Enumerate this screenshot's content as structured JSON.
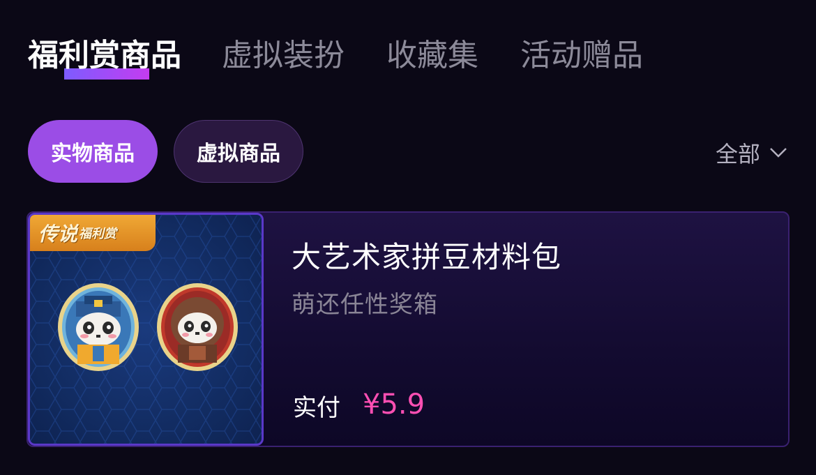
{
  "tabs": [
    {
      "label": "福利赏商品",
      "active": true
    },
    {
      "label": "虚拟装扮",
      "active": false
    },
    {
      "label": "收藏集",
      "active": false
    },
    {
      "label": "活动赠品",
      "active": false
    }
  ],
  "chips": {
    "physical": "实物商品",
    "virtual": "虚拟商品"
  },
  "filter": {
    "label": "全部",
    "icon": "chevron-down-icon"
  },
  "product": {
    "badge_main": "传说",
    "badge_sub": "福利赏",
    "title": "大艺术家拼豆材料包",
    "subtitle": "萌还任性奖箱",
    "pay_label": "实付",
    "price": "¥5.9"
  },
  "colors": {
    "background": "#0b0816",
    "accent_purple": "#9b4de6",
    "price_pink": "#ff4fb3",
    "badge_orange": "#e89528"
  }
}
